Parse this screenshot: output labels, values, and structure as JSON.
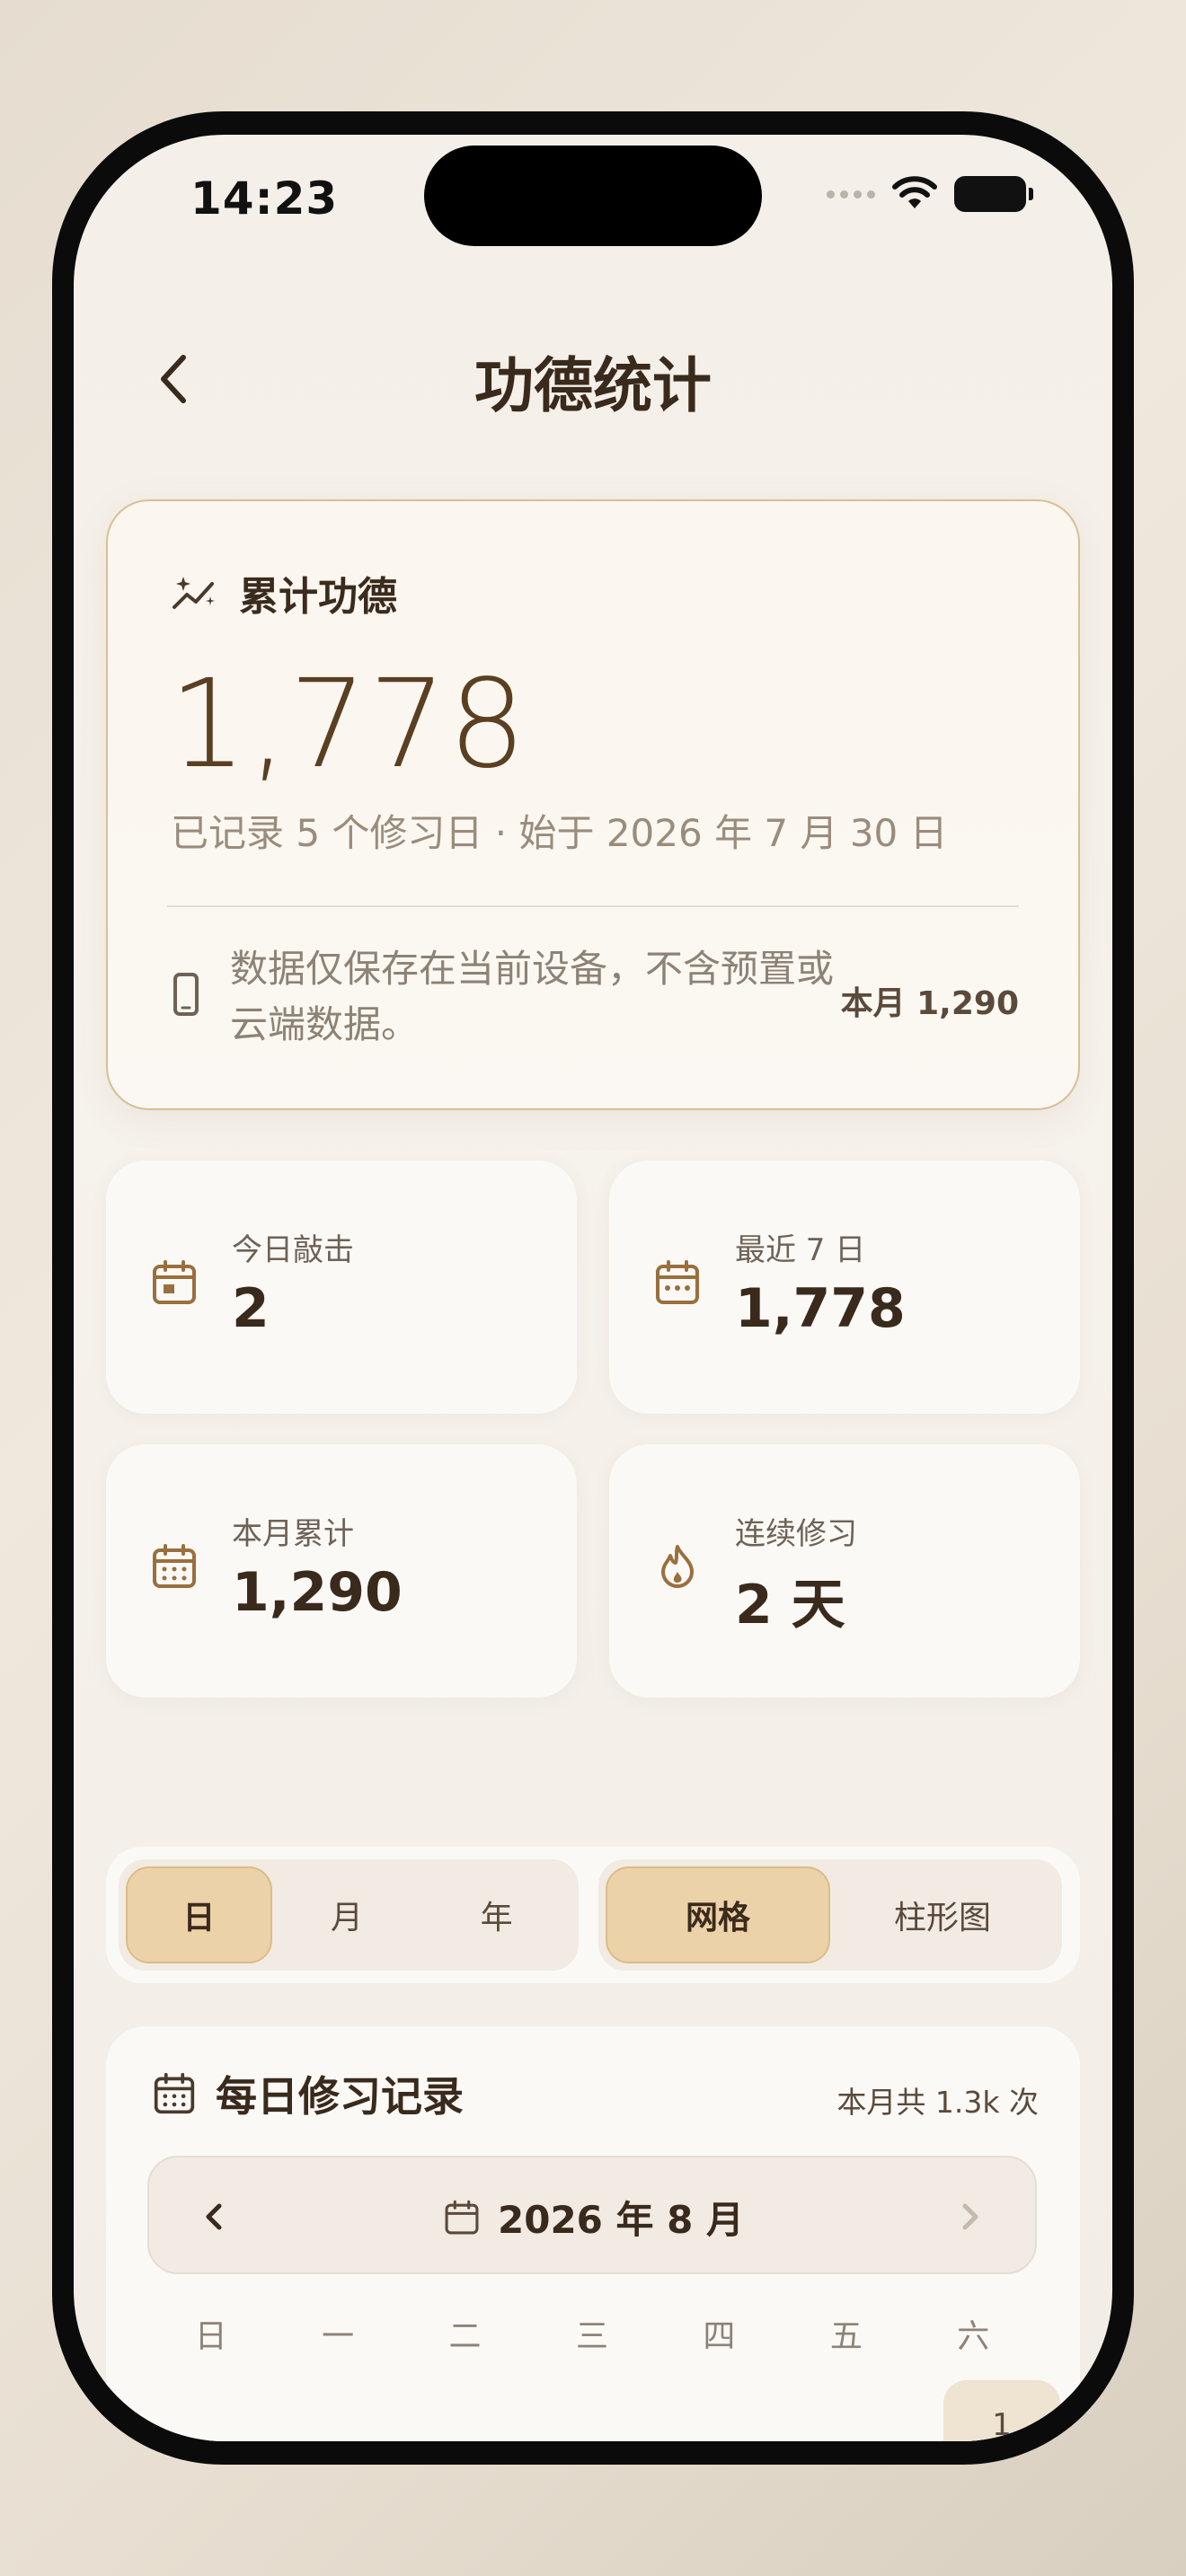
{
  "status_bar": {
    "time": "14:23"
  },
  "nav": {
    "title": "功德统计",
    "back_icon": "chevron-left-icon"
  },
  "hero": {
    "label": "累计功德",
    "value": "1,778",
    "subtitle": "已记录 5 个修习日 · 始于 2026 年 7 月 30 日",
    "note": "数据仅保存在当前设备，不含预置或云端数据。",
    "month_total": "本月 1,290"
  },
  "stats": [
    {
      "label": "今日敲击",
      "value": "2",
      "icon": "calendar-icon"
    },
    {
      "label": "最近 7 日",
      "value": "1,778",
      "icon": "calendar-week-icon"
    },
    {
      "label": "本月累计",
      "value": "1,290",
      "icon": "calendar-month-icon"
    },
    {
      "label": "连续修习",
      "value": "2 天",
      "icon": "flame-icon"
    }
  ],
  "period_segment": [
    "日",
    "月",
    "年"
  ],
  "view_segment": [
    "网格",
    "柱形图"
  ],
  "record": {
    "title": "每日修习记录",
    "total": "本月共 1.3k 次",
    "month": "2026 年 8 月",
    "weekdays": [
      "日",
      "一",
      "二",
      "三",
      "四",
      "五",
      "六"
    ],
    "first_day": "1"
  },
  "colors": {
    "accent": "#ecd2a8",
    "brown": "#5a3f22",
    "border": "#d9bf95"
  }
}
